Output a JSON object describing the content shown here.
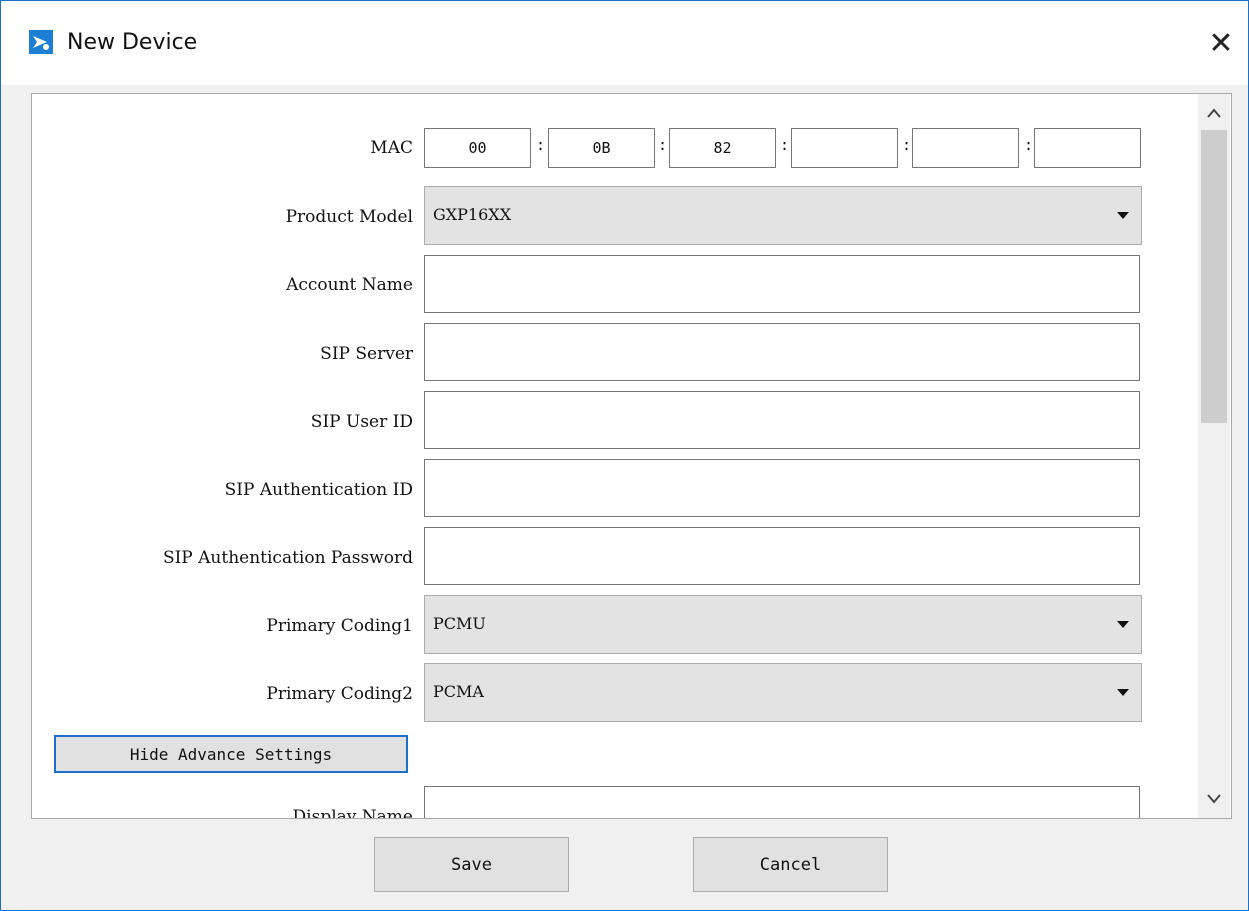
{
  "window": {
    "title": "New Device",
    "close_glyph": "✕"
  },
  "form": {
    "mac": {
      "label": "MAC",
      "octets": [
        "00",
        "0B",
        "82",
        "",
        "",
        ""
      ],
      "separator": ":"
    },
    "product_model": {
      "label": "Product Model",
      "value": "GXP16XX"
    },
    "account_name": {
      "label": "Account Name",
      "value": ""
    },
    "sip_server": {
      "label": "SIP Server",
      "value": ""
    },
    "sip_user_id": {
      "label": "SIP User ID",
      "value": ""
    },
    "sip_auth_id": {
      "label": "SIP Authentication ID",
      "value": ""
    },
    "sip_auth_password": {
      "label": "SIP Authentication Password",
      "value": ""
    },
    "primary_coding1": {
      "label": "Primary Coding1",
      "value": "PCMU"
    },
    "primary_coding2": {
      "label": "Primary Coding2",
      "value": "PCMA"
    },
    "advance_button": "Hide Advance Settings",
    "display_name": {
      "label": "Display Name",
      "value": ""
    }
  },
  "scrollbar": {
    "up_glyph": "^",
    "down_glyph": "v"
  },
  "footer": {
    "save": "Save",
    "cancel": "Cancel"
  },
  "colors": {
    "accent": "#1e6fc9",
    "app_icon": "#1d7fd4"
  },
  "icons": {
    "app": "grandstream-logo-icon",
    "close": "close-icon"
  }
}
